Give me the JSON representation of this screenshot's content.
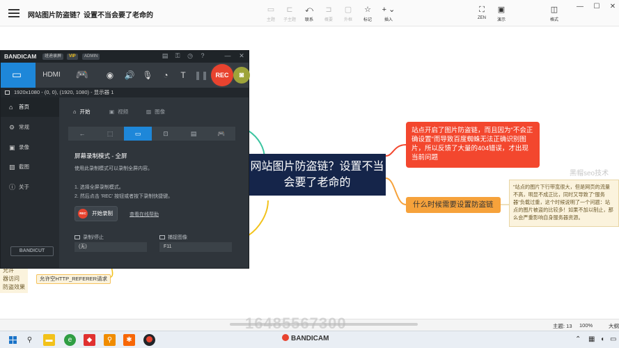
{
  "app": {
    "doc_title": "网站图片防盗链？设置不当会要了老命的"
  },
  "toolbar": {
    "items": [
      {
        "label": "主题",
        "icon": "topic-icon"
      },
      {
        "label": "子主题",
        "icon": "subtopic-icon"
      },
      {
        "label": "联系",
        "icon": "relation-icon"
      },
      {
        "label": "概要",
        "icon": "summary-icon"
      },
      {
        "label": "外框",
        "icon": "boundary-icon"
      },
      {
        "label": "标记",
        "icon": "star-icon"
      },
      {
        "label": "插入",
        "icon": "plus-icon"
      },
      {
        "label": "ZEN",
        "icon": "zen-icon"
      },
      {
        "label": "演示",
        "icon": "play-icon"
      },
      {
        "label": "格式",
        "icon": "format-icon"
      }
    ]
  },
  "mindmap": {
    "central": "网站图片防盗链？设置不当会要了老命的",
    "node_red": "站点开启了图片防盗链，而且因为\"不会正确设置\"而导致百度蜘蛛无法正确识别图片，所以反馈了大量的404错误，才出现当前问题",
    "node_orange": "什么时候需要设置防盗链",
    "note": "\"站点的图片下行带宽很大，但是网页的流量不高，明显不成正比，同时又导致了\"服务器\"负载过重，这个时候说明了一个问题：站点的图片被盗的比较多！如果不加以制止，那么会严重影响自身服务器资源。",
    "watermark_right": "黑帽seo技术",
    "left_fragments": [
      "允许",
      "器访问",
      "防盗效果"
    ],
    "left_node": "允许空HTTP_REFERER请求",
    "colors": {
      "central": "#15254a",
      "red": "#f3472e",
      "orange": "#f6a23b",
      "green_line": "#3cc4a0",
      "yellow_line": "#f2c21b"
    }
  },
  "bandicam": {
    "title": "BANDICAM",
    "tag1": "班迪录屏",
    "vip": "VIP",
    "tag2": "ADMIN",
    "mode_hdmi": "HDMI",
    "rec": "REC",
    "resolution": "1920x1080 - (0, 0), (1920, 1080) - 显示器 1",
    "sidebar": [
      {
        "label": "首页",
        "icon": "home-icon"
      },
      {
        "label": "常规",
        "icon": "gear-icon"
      },
      {
        "label": "录像",
        "icon": "video-icon"
      },
      {
        "label": "截图",
        "icon": "image-icon"
      },
      {
        "label": "关于",
        "icon": "info-icon"
      }
    ],
    "bandicut": "BANDICUT",
    "tabs": [
      {
        "label": "开始",
        "icon": "home-icon"
      },
      {
        "label": "视频",
        "icon": "film-icon"
      },
      {
        "label": "图像",
        "icon": "image-icon"
      }
    ],
    "mode_heading": "屏幕录制模式 - 全屏",
    "mode_desc": "使用此录制模式可以录制全屏内容。",
    "step1": "1. 选择全屏录制模式。",
    "step2": "2. 然后点击 'REC' 按钮或者按下录制快捷键。",
    "start_rec": "开始录制",
    "help_link": "查看在线帮助",
    "hotkey_rec_label": "录制/停止",
    "hotkey_rec_value": "(无)",
    "hotkey_cap_label": "捕捉图像",
    "hotkey_cap_value": "F11"
  },
  "statusbar": {
    "phone_watermark": "16485567300",
    "topic_count": "主题: 13",
    "zoom": "100%",
    "more": "大纲"
  },
  "taskbar": {
    "bandicam_watermark": "BANDICAM"
  }
}
